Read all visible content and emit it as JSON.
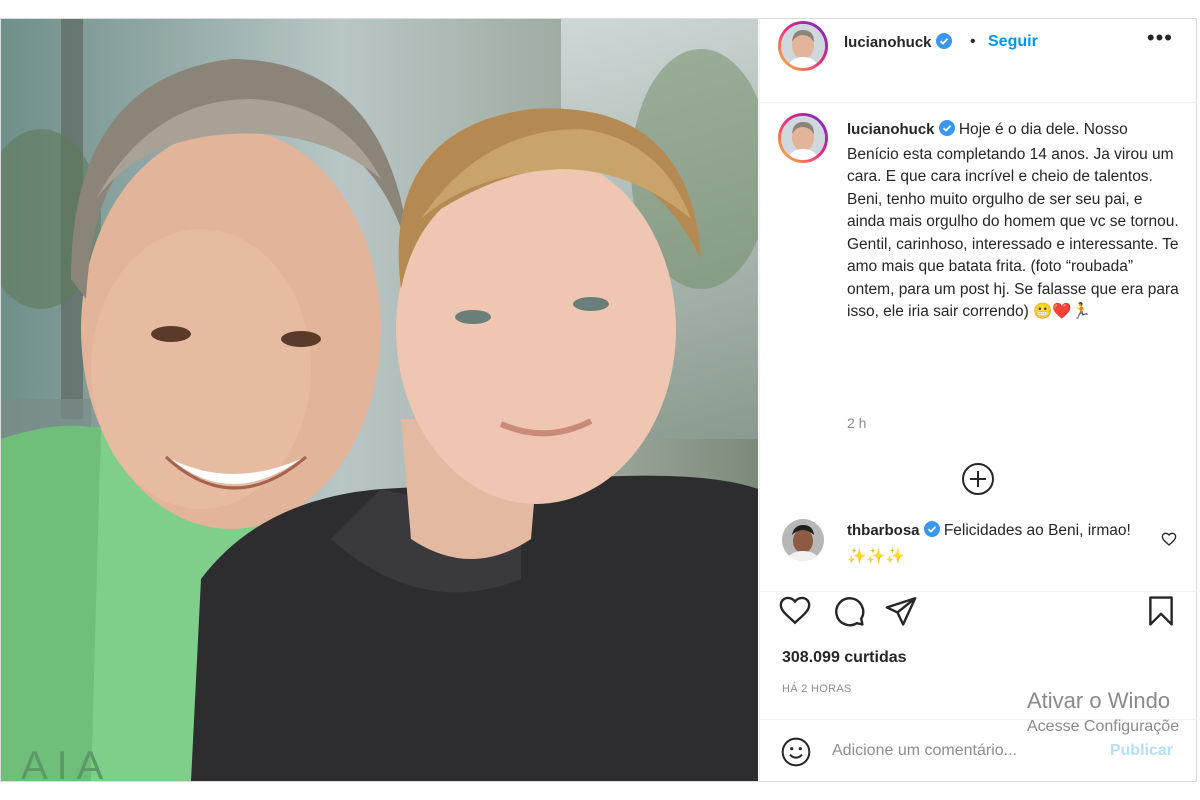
{
  "post": {
    "username": "lucianohuck",
    "follow_label": "Seguir",
    "dot": "•",
    "more_label": "•••",
    "caption": "Hoje é o dia dele. Nosso Benício esta completando 14 anos. Ja virou um cara. E que cara incrível e cheio de talentos. Beni, tenho muito orgulho de ser seu pai, e ainda mais orgulho do homem que vc se tornou. Gentil, carinhoso, interessado e interessante. Te amo mais que batata frita. (foto “roubada” ontem, para um post hj. Se falasse que era para isso, ele iria sair correndo) 😬❤️🏃",
    "caption_time": "2 h",
    "likes": "308.099 curtidas",
    "posted_ago": "HÁ 2 HORAS"
  },
  "comments": [
    {
      "username": "thbarbosa",
      "text": "Felicidades ao Beni, irmao! ✨✨✨"
    }
  ],
  "comment_box": {
    "placeholder": "Adicione um comentário...",
    "publish_label": "Publicar"
  },
  "watermark": {
    "line1": "Ativar o Windo",
    "line2": "Acesse Configuraçõe"
  },
  "icons": [
    "verified-badge-icon",
    "more-options-icon",
    "load-more-comments-icon",
    "like-comment-icon",
    "heart-icon",
    "comment-icon",
    "share-icon",
    "bookmark-icon",
    "emoji-icon"
  ],
  "colors": {
    "link_blue": "#0095f6",
    "publish_disabled": "#b2dffc",
    "verified_blue": "#3897f0"
  }
}
